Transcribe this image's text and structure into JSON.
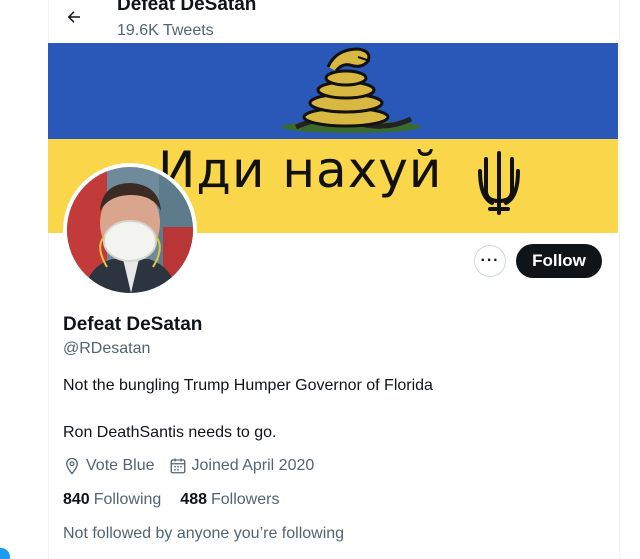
{
  "header": {
    "back_icon": "arrow-left-icon",
    "name": "Defeat DeSatan",
    "tweet_count": "19.6K Tweets"
  },
  "banner": {
    "text": "Иди нахуй",
    "colors": {
      "top": "#2a58b8",
      "bottom": "#f9d64a"
    }
  },
  "actions": {
    "more_label": "···",
    "follow_label": "Follow"
  },
  "profile": {
    "name": "Defeat DeSatan",
    "handle": "@RDesatan",
    "bio_line1": "Not the bungling Trump Humper Governor of Florida",
    "bio_line2": "Ron DeathSantis needs to go.",
    "location": "Vote Blue",
    "joined": "Joined April 2020",
    "following_count": "840",
    "following_label": "Following",
    "followers_count": "488",
    "followers_label": "Followers",
    "not_followed": "Not followed by anyone you’re following"
  }
}
